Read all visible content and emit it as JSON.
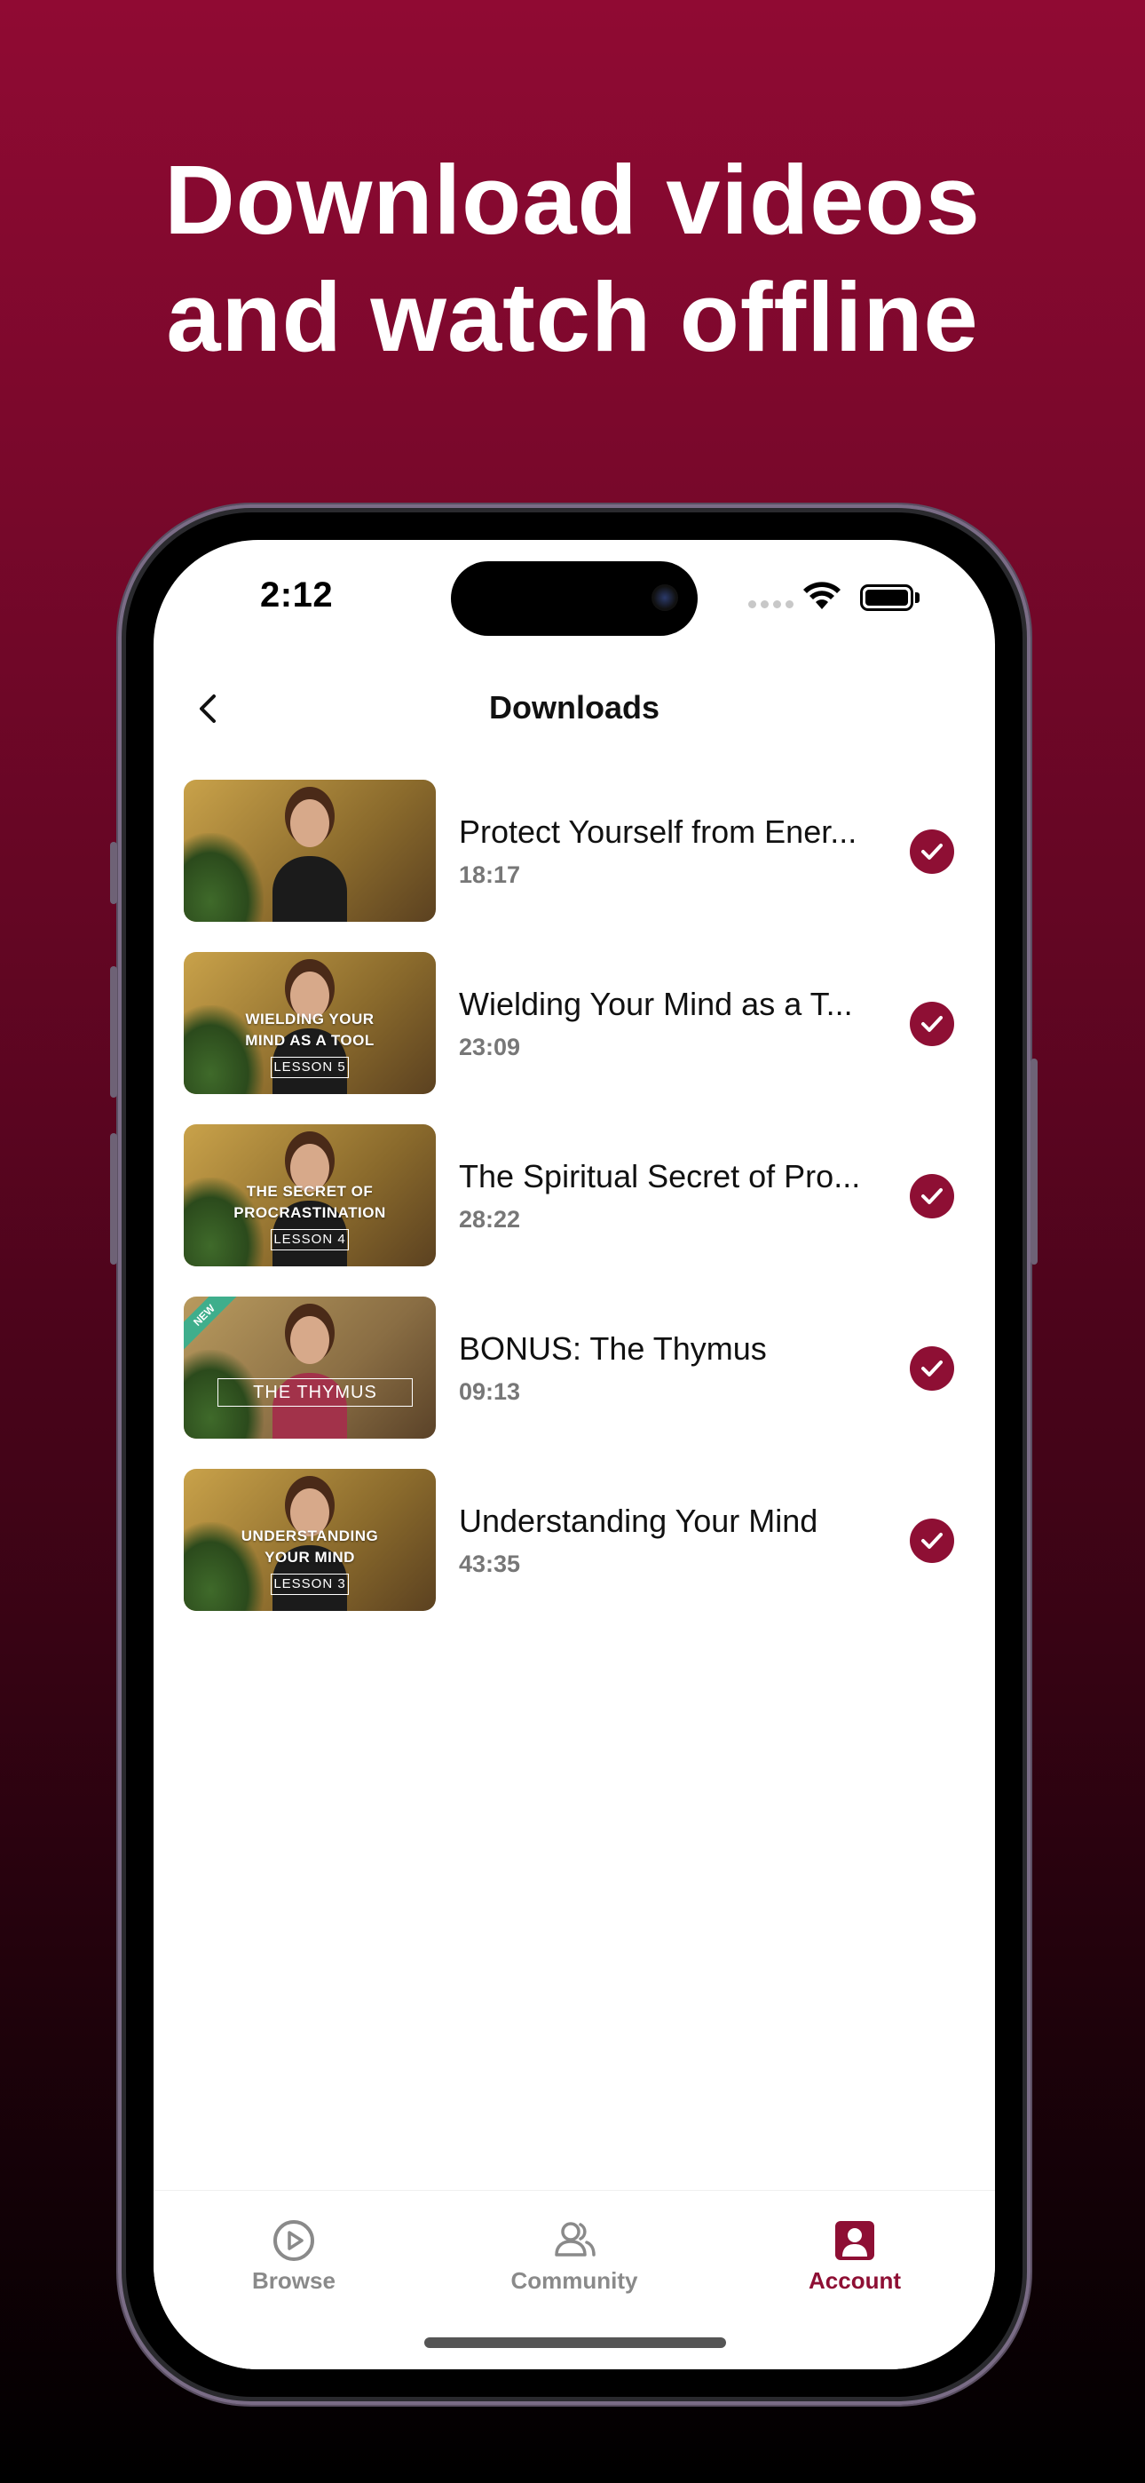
{
  "promo": {
    "line1": "Download videos",
    "line2": "and watch offline"
  },
  "status_bar": {
    "time": "2:12"
  },
  "header": {
    "title": "Downloads",
    "back_icon": "chevron-left-icon"
  },
  "downloads": [
    {
      "title": "Protect Yourself from Ener...",
      "duration": "18:17",
      "thumb_caption": "",
      "thumb_lesson": ""
    },
    {
      "title": "Wielding Your Mind as a T...",
      "duration": "23:09",
      "thumb_caption": "WIELDING YOUR MIND AS A TOOL",
      "thumb_lesson": "LESSON 5"
    },
    {
      "title": "The Spiritual Secret of Pro...",
      "duration": "28:22",
      "thumb_caption": "THE SECRET OF PROCRASTINATION",
      "thumb_lesson": "LESSON 4"
    },
    {
      "title": "BONUS: The Thymus",
      "duration": "09:13",
      "thumb_caption": "THE THYMUS",
      "thumb_badge": "NEW"
    },
    {
      "title": "Understanding Your Mind",
      "duration": "43:35",
      "thumb_caption": "UNDERSTANDING YOUR MIND",
      "thumb_lesson": "LESSON 3"
    }
  ],
  "tabbar": {
    "tabs": [
      {
        "label": "Browse",
        "icon": "play-circle-icon",
        "active": false
      },
      {
        "label": "Community",
        "icon": "people-icon",
        "active": false
      },
      {
        "label": "Account",
        "icon": "account-icon",
        "active": true
      }
    ]
  },
  "colors": {
    "accent": "#8e0f34",
    "bg_top": "#900a33",
    "bg_bottom": "#000000"
  }
}
